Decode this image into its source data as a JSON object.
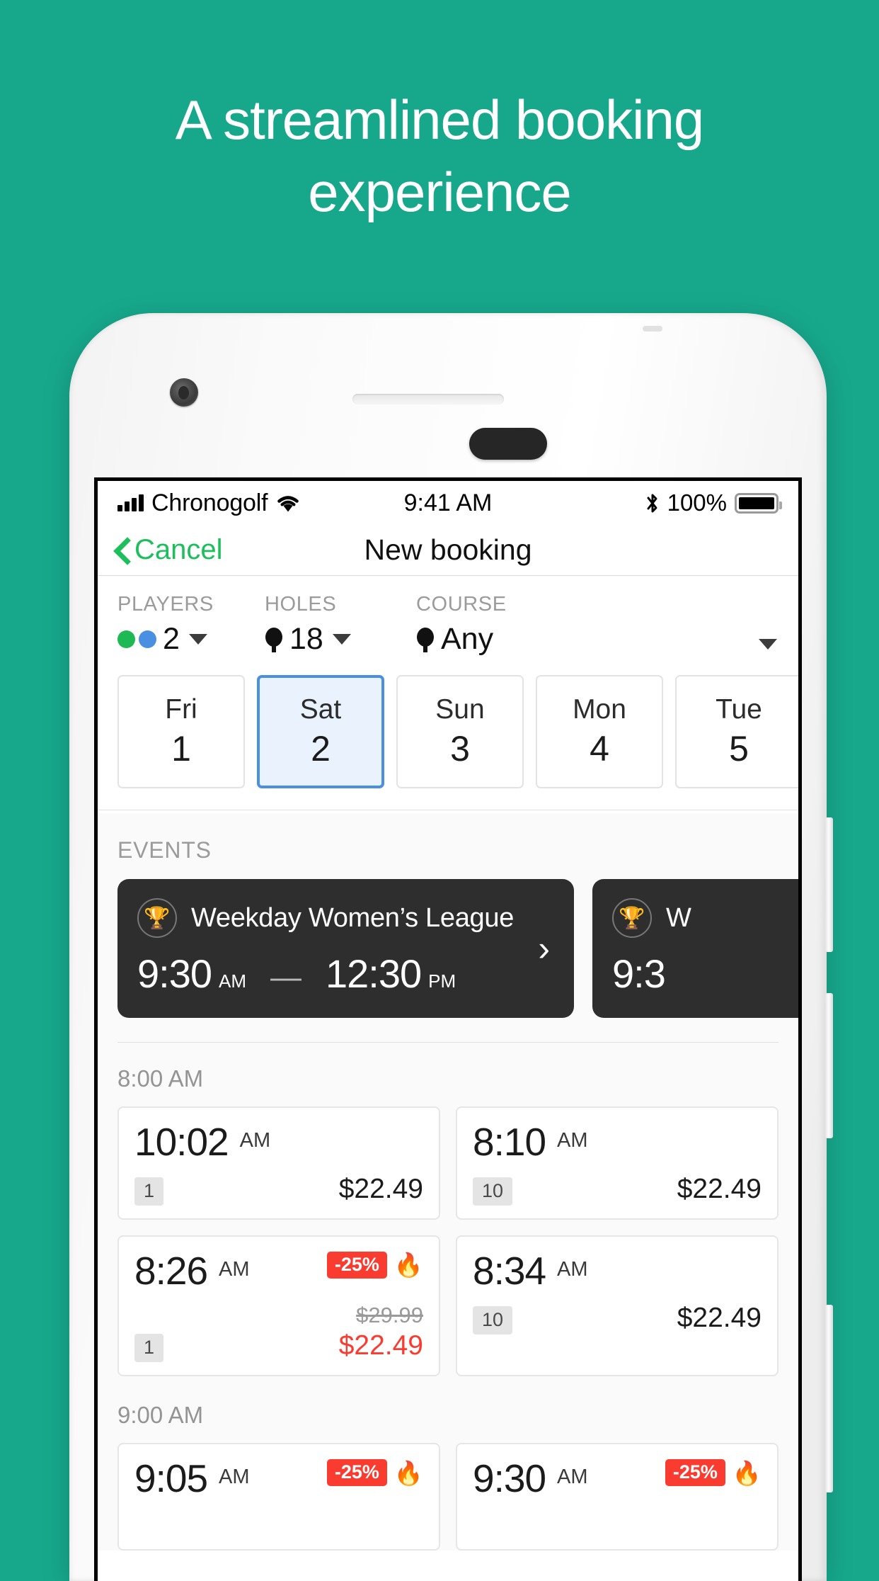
{
  "promo": {
    "headline_line1": "A streamlined booking",
    "headline_line2": "experience",
    "background_color": "#17a88c"
  },
  "status_bar": {
    "carrier": "Chronogolf",
    "time": "9:41 AM",
    "battery_percent": "100%",
    "signal_icon": "signal-bars-icon",
    "wifi_icon": "wifi-icon",
    "bluetooth_icon": "bluetooth-icon",
    "battery_icon": "battery-full-icon"
  },
  "navbar": {
    "back_label": "Cancel",
    "title": "New booking",
    "back_icon": "chevron-left-icon",
    "accent_color": "#1dbf5c"
  },
  "filters": {
    "players": {
      "label": "PLAYERS",
      "value": "2",
      "dot_colors": [
        "#1db954",
        "#4a90e2"
      ]
    },
    "holes": {
      "label": "HOLES",
      "value": "18",
      "icon": "golf-tee-icon"
    },
    "course": {
      "label": "COURSE",
      "value": "Any",
      "icon": "golf-tee-icon"
    }
  },
  "dates": {
    "selected_index": 1,
    "selected_color": "#4a90e2",
    "items": [
      {
        "day": "Fri",
        "num": "1"
      },
      {
        "day": "Sat",
        "num": "2"
      },
      {
        "day": "Sun",
        "num": "3"
      },
      {
        "day": "Mon",
        "num": "4"
      },
      {
        "day": "Tue",
        "num": "5"
      }
    ]
  },
  "events": {
    "section_label": "EVENTS",
    "items": [
      {
        "icon": "trophy-icon",
        "name": "Weekday Women’s League",
        "start_time": "9:30",
        "start_meridiem": "AM",
        "dash": "—",
        "end_time": "12:30",
        "end_meridiem": "PM",
        "arrow": "›"
      },
      {
        "icon": "trophy-icon",
        "name": "W",
        "start_time": "9:3",
        "start_meridiem": "",
        "dash": "",
        "end_time": "",
        "end_meridiem": "",
        "arrow": ""
      }
    ]
  },
  "tee_times": [
    {
      "group_label": "8:00 AM",
      "slots": [
        {
          "time": "10:02",
          "meridiem": "AM",
          "spots": "1",
          "price": "$22.49",
          "old_price": "",
          "discount": "",
          "hot": false,
          "discounted": false
        },
        {
          "time": "8:10",
          "meridiem": "AM",
          "spots": "10",
          "price": "$22.49",
          "old_price": "",
          "discount": "",
          "hot": false,
          "discounted": false
        },
        {
          "time": "8:26",
          "meridiem": "AM",
          "spots": "1",
          "price": "$22.49",
          "old_price": "$29.99",
          "discount": "-25%",
          "hot": true,
          "discounted": true
        },
        {
          "time": "8:34",
          "meridiem": "AM",
          "spots": "10",
          "price": "$22.49",
          "old_price": "",
          "discount": "",
          "hot": false,
          "discounted": false
        }
      ]
    },
    {
      "group_label": "9:00 AM",
      "slots": [
        {
          "time": "9:05",
          "meridiem": "AM",
          "spots": "",
          "price": "",
          "old_price": "",
          "discount": "-25%",
          "hot": true,
          "discounted": true
        },
        {
          "time": "9:30",
          "meridiem": "AM",
          "spots": "",
          "price": "",
          "old_price": "",
          "discount": "-25%",
          "hot": true,
          "discounted": true
        }
      ]
    }
  ],
  "flame_icon": "flame-icon",
  "discount_color": "#fa3c30"
}
